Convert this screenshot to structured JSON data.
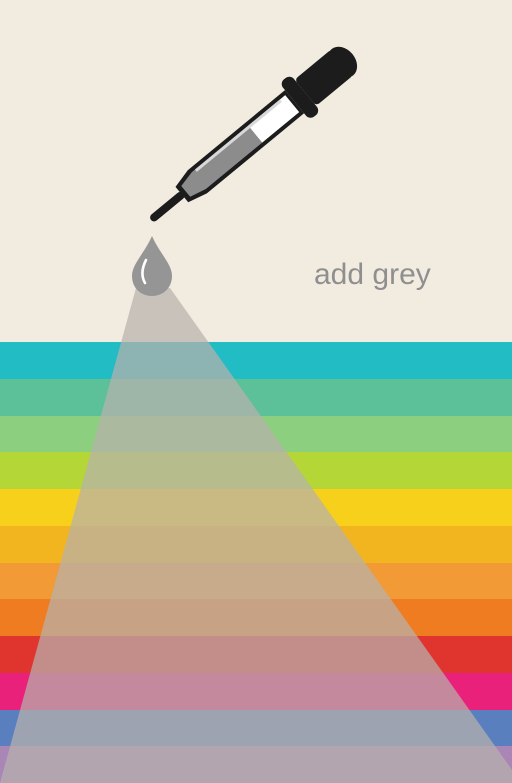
{
  "caption": "add grey",
  "icons": {
    "dropper": "eyedropper-icon",
    "drop": "water-drop-icon"
  },
  "colors": {
    "background": "#f2ece0",
    "grey": "#b7b2ac",
    "stripes": [
      "#22bcc4",
      "#5cc199",
      "#8ccf7f",
      "#b4d636",
      "#f6d01a",
      "#f2b51f",
      "#f29a35",
      "#f07c22",
      "#e0352f",
      "#e9217a",
      "#5a7fbf",
      "#a986b6"
    ]
  }
}
